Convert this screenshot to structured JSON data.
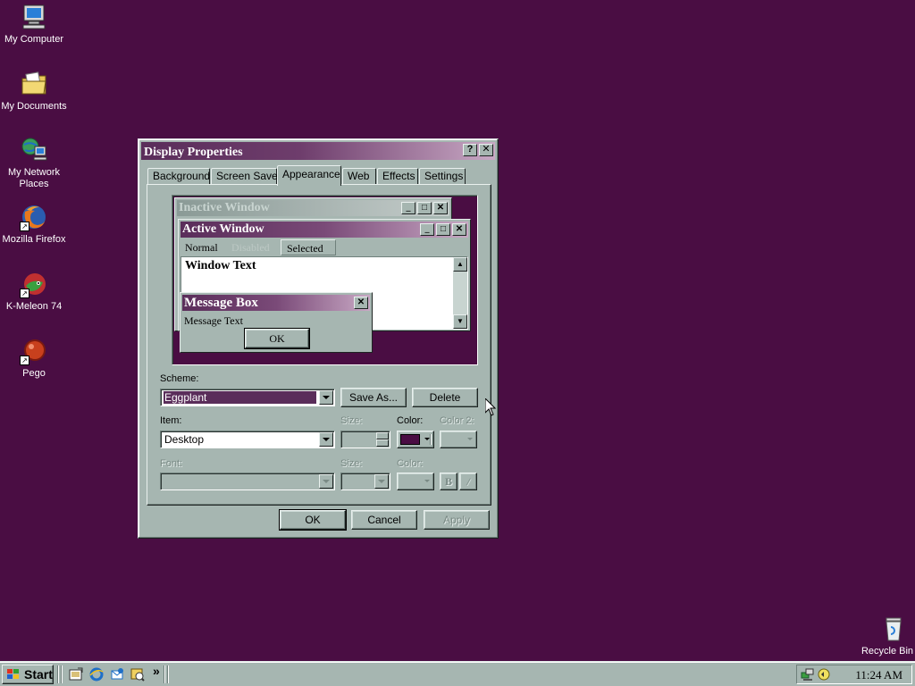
{
  "desktop": {
    "icons": [
      {
        "label": "My Computer",
        "icon": "computer-icon"
      },
      {
        "label": "My Documents",
        "icon": "folder-icon"
      },
      {
        "label": "My Network Places",
        "icon": "network-icon"
      },
      {
        "label": "Mozilla Firefox",
        "icon": "firefox-icon"
      },
      {
        "label": "K-Meleon 74",
        "icon": "kmeleon-icon"
      },
      {
        "label": "Pego",
        "icon": "pego-icon"
      },
      {
        "label": "Recycle Bin",
        "icon": "recycle-bin-icon"
      }
    ],
    "background_color": "#4a0d43"
  },
  "dialog": {
    "title": "Display Properties",
    "help_label": "?",
    "close_label": "✕",
    "tabs": [
      "Background",
      "Screen Saver",
      "Appearance",
      "Web",
      "Effects",
      "Settings"
    ],
    "active_tab": "Appearance",
    "preview": {
      "inactive_title": "Inactive Window",
      "active_title": "Active Window",
      "menu": {
        "normal": "Normal",
        "disabled": "Disabled",
        "selected": "Selected"
      },
      "window_text": "Window Text",
      "message_title": "Message Box",
      "message_text": "Message Text",
      "ok_label": "OK"
    },
    "scheme": {
      "label": "Scheme:",
      "value": "Eggplant",
      "save_as_label": "Save As...",
      "delete_label": "Delete"
    },
    "item": {
      "label": "Item:",
      "value": "Desktop",
      "size_label": "Size:",
      "color_label": "Color:",
      "color2_label": "Color 2:",
      "color_value": "#4a0d43"
    },
    "font": {
      "label": "Font:",
      "size_label": "Size:",
      "color_label": "Color:",
      "bold_label": "B",
      "italic_label": "/"
    },
    "buttons": {
      "ok": "OK",
      "cancel": "Cancel",
      "apply": "Apply"
    }
  },
  "taskbar": {
    "start_label": "Start",
    "quick_launch": [
      "desktop-icon",
      "internet-explorer-icon",
      "outlook-express-icon",
      "channels-icon"
    ],
    "more_label": "»",
    "clock": "11:24 AM"
  }
}
